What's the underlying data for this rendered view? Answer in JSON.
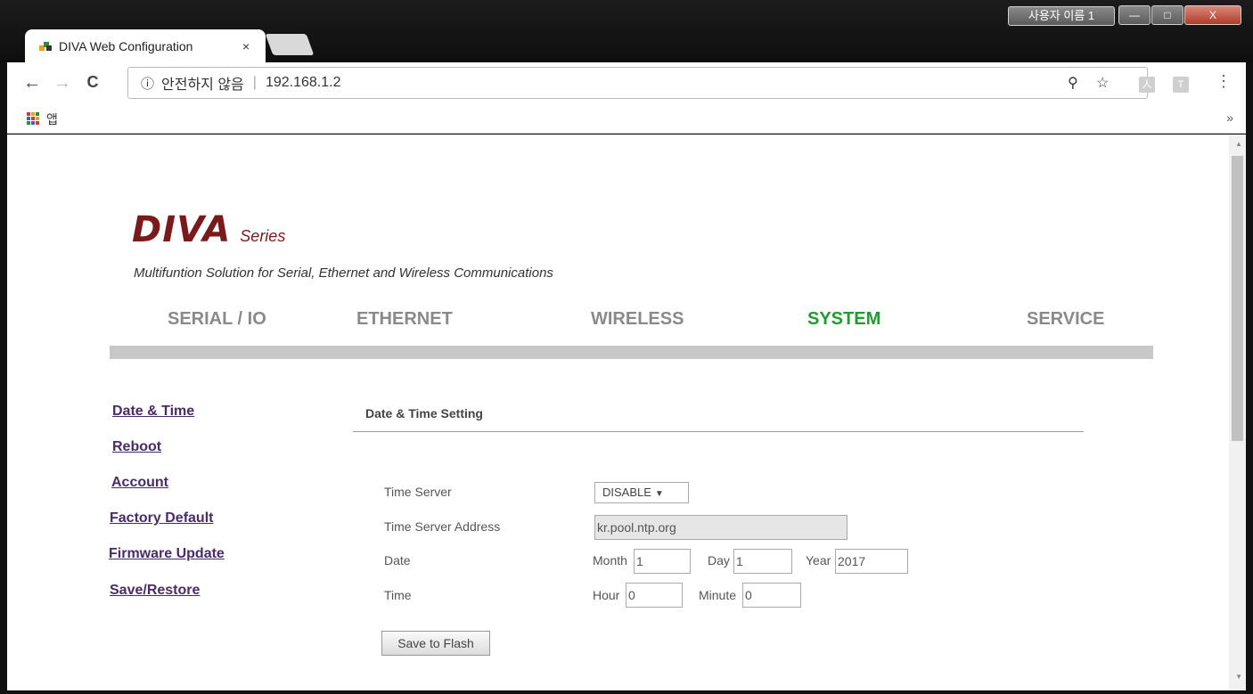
{
  "window": {
    "user_badge": "사용자 이름 1",
    "minimize": "—",
    "maximize": "□",
    "close": "X"
  },
  "browser": {
    "tab_title": "DIVA Web Configuration",
    "tab_close": "×",
    "back": "←",
    "forward": "→",
    "reload": "C",
    "info_icon": "ⓘ",
    "security_text": "안전하지 않음",
    "url": "192.168.1.2",
    "ext1": "人",
    "ext2": "T",
    "menu": "⋮",
    "apps_label": "앱",
    "more_bookmarks": "»"
  },
  "brand": {
    "name": "DIVA",
    "series": "Series",
    "tagline": "Multifuntion Solution for Serial, Ethernet and Wireless Communications",
    "color": "#7a1a1a"
  },
  "topnav": {
    "items": [
      "SERIAL / IO",
      "ETHERNET",
      "WIRELESS",
      "SYSTEM",
      "SERVICE"
    ],
    "active": "SYSTEM",
    "active_color": "#1f9d2e"
  },
  "sidemenu": {
    "items": [
      "Date & Time",
      "Reboot",
      "Account",
      "Factory Default",
      "Firmware Update",
      "Save/Restore"
    ]
  },
  "section": {
    "title": "Date & Time Setting"
  },
  "form": {
    "time_server_label": "Time Server",
    "time_server_value": "DISABLE",
    "time_server_address_label": "Time Server Address",
    "time_server_address_value": "kr.pool.ntp.org",
    "date_label": "Date",
    "month_label": "Month",
    "month_value": "1",
    "day_label": "Day",
    "day_value": "1",
    "year_label": "Year",
    "year_value": "2017",
    "time_label": "Time",
    "hour_label": "Hour",
    "hour_value": "0",
    "minute_label": "Minute",
    "minute_value": "0",
    "save_button": "Save to Flash"
  }
}
